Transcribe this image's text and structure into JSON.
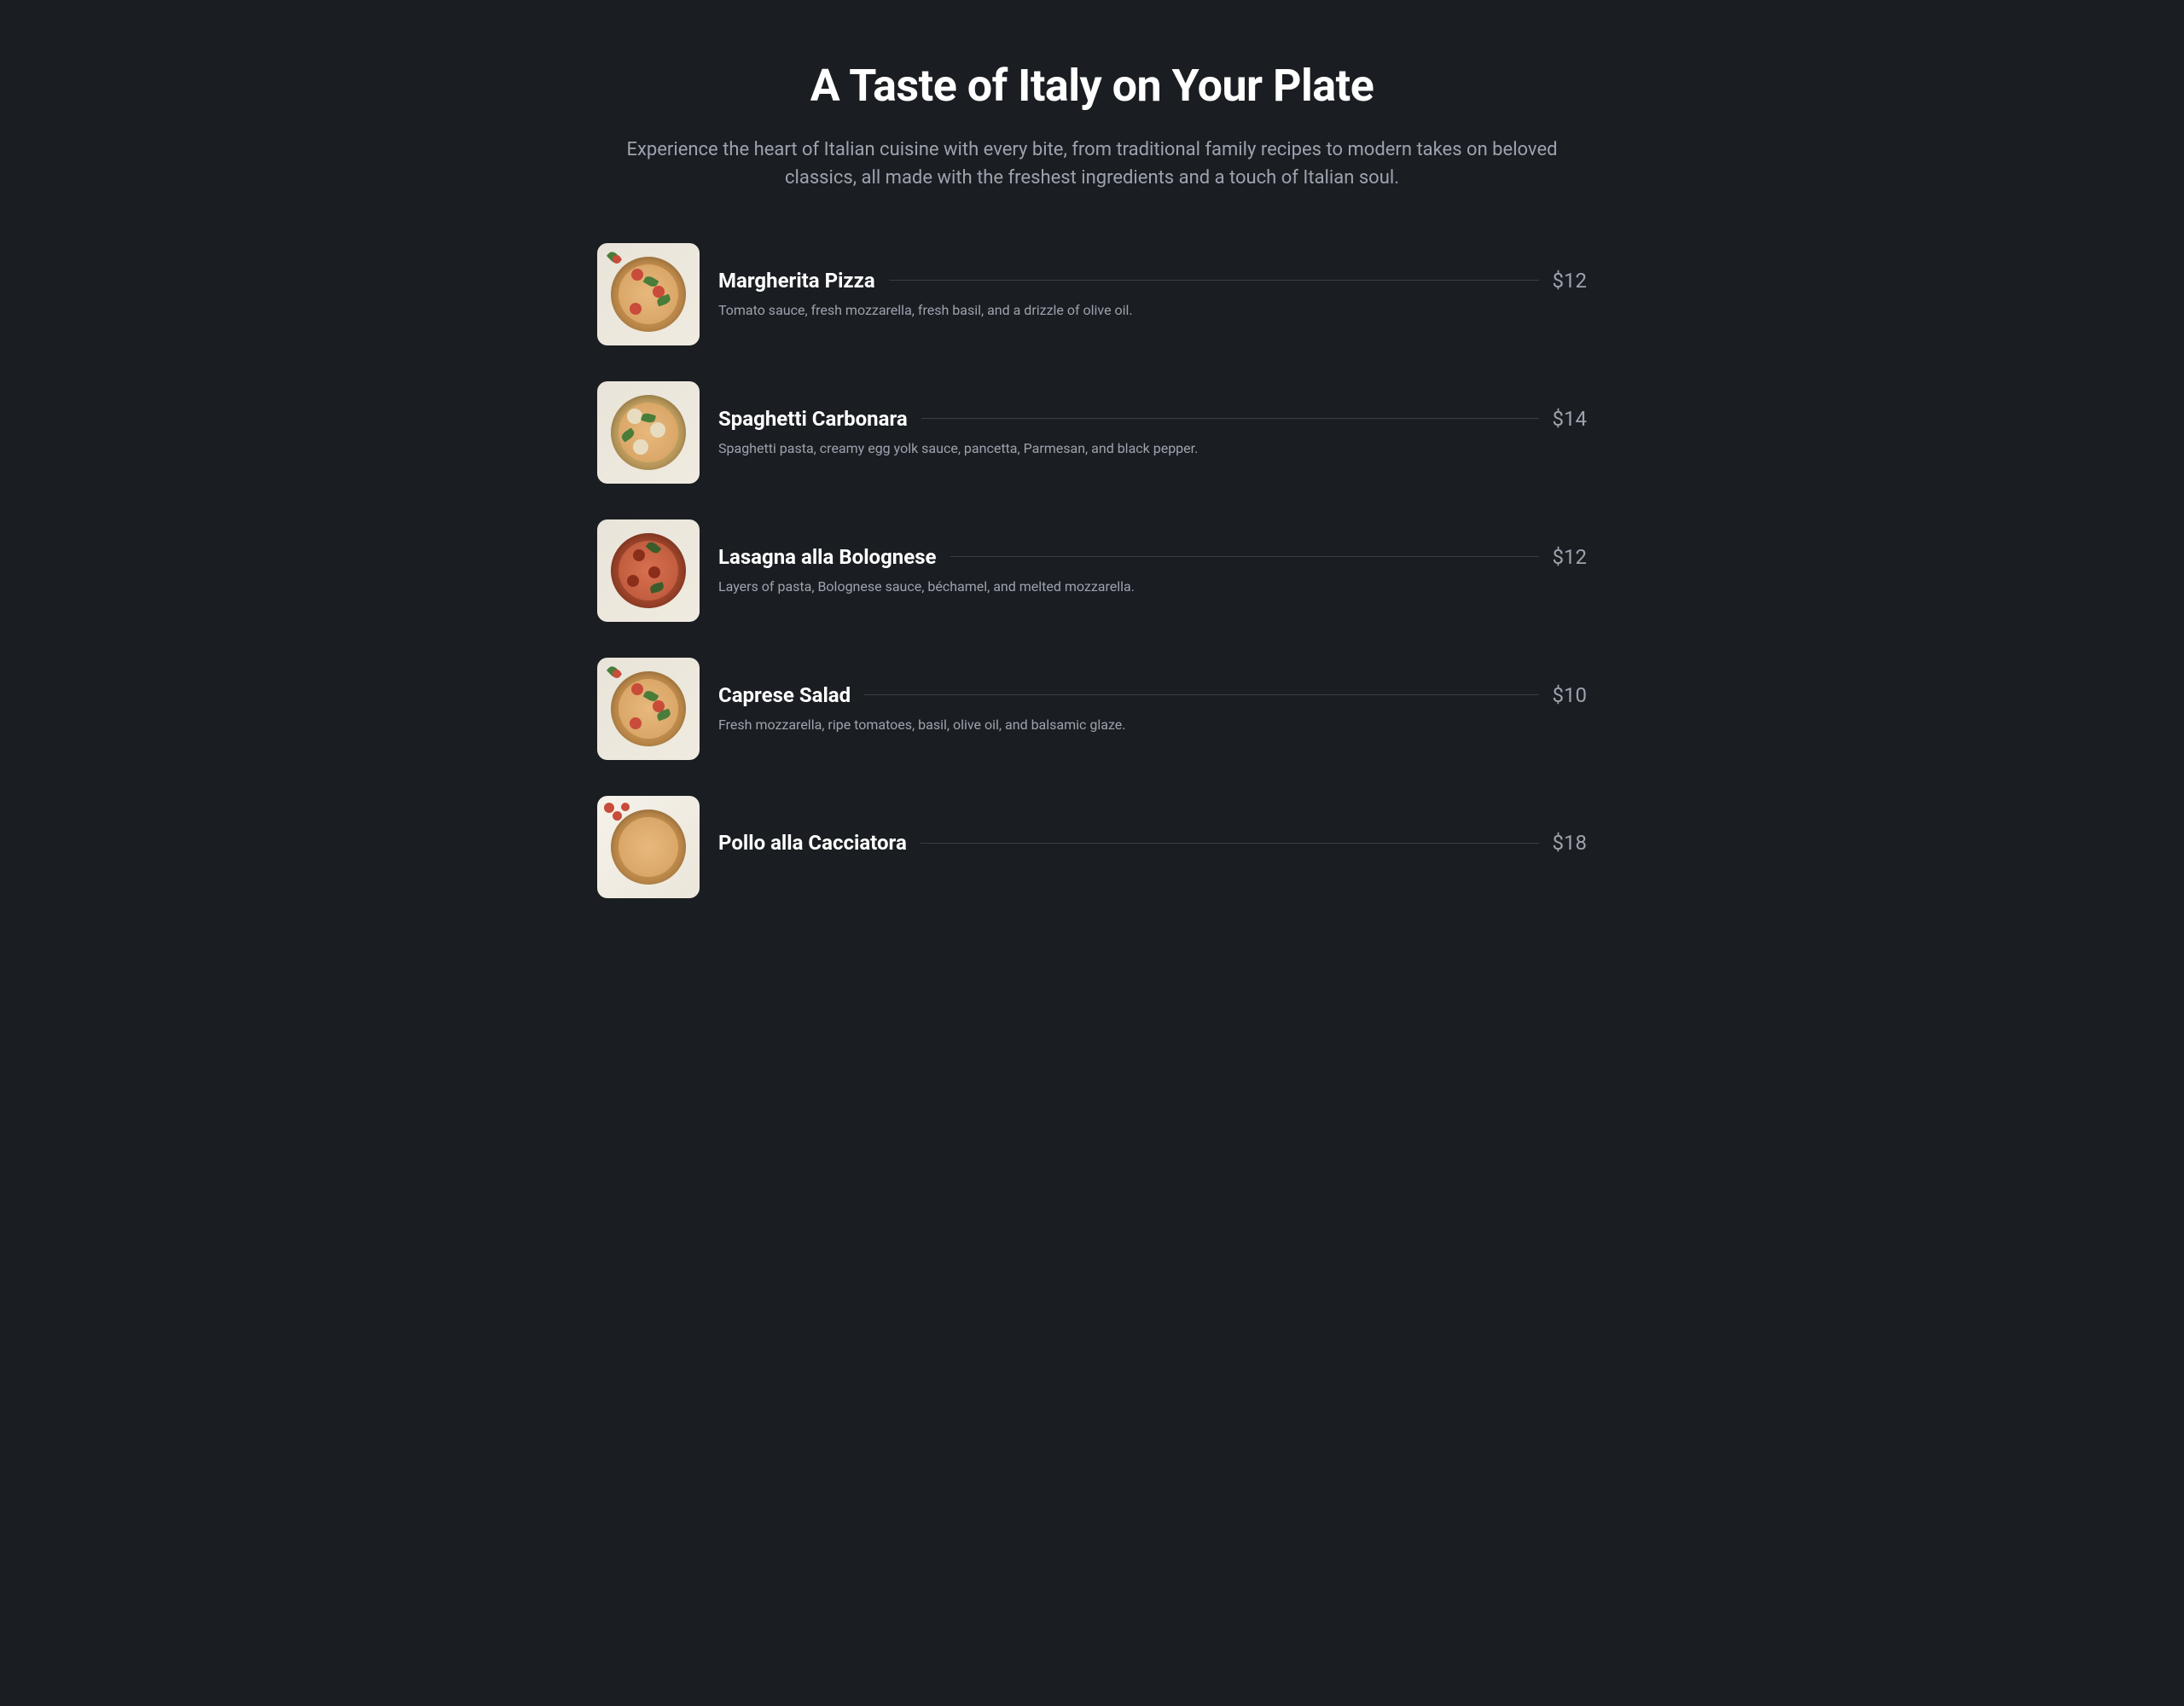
{
  "header": {
    "title": "A Taste of Italy on Your Plate",
    "subtitle": "Experience the heart of Italian cuisine with every bite, from traditional family recipes to modern takes on beloved classics, all made with the freshest ingredients and a touch of Italian soul."
  },
  "menu_items": [
    {
      "name": "Margherita Pizza",
      "price": "$12",
      "description": "Tomato sauce, fresh mozzarella, fresh basil, and a drizzle of olive oil."
    },
    {
      "name": "Spaghetti Carbonara",
      "price": "$14",
      "description": "Spaghetti pasta, creamy egg yolk sauce, pancetta, Parmesan, and black pepper."
    },
    {
      "name": "Lasagna alla Bolognese",
      "price": "$12",
      "description": "Layers of pasta, Bolognese sauce, béchamel, and melted mozzarella."
    },
    {
      "name": "Caprese Salad",
      "price": "$10",
      "description": "Fresh mozzarella, ripe tomatoes, basil, olive oil, and balsamic glaze."
    },
    {
      "name": "Pollo alla Cacciatora",
      "price": "$18",
      "description": ""
    }
  ]
}
